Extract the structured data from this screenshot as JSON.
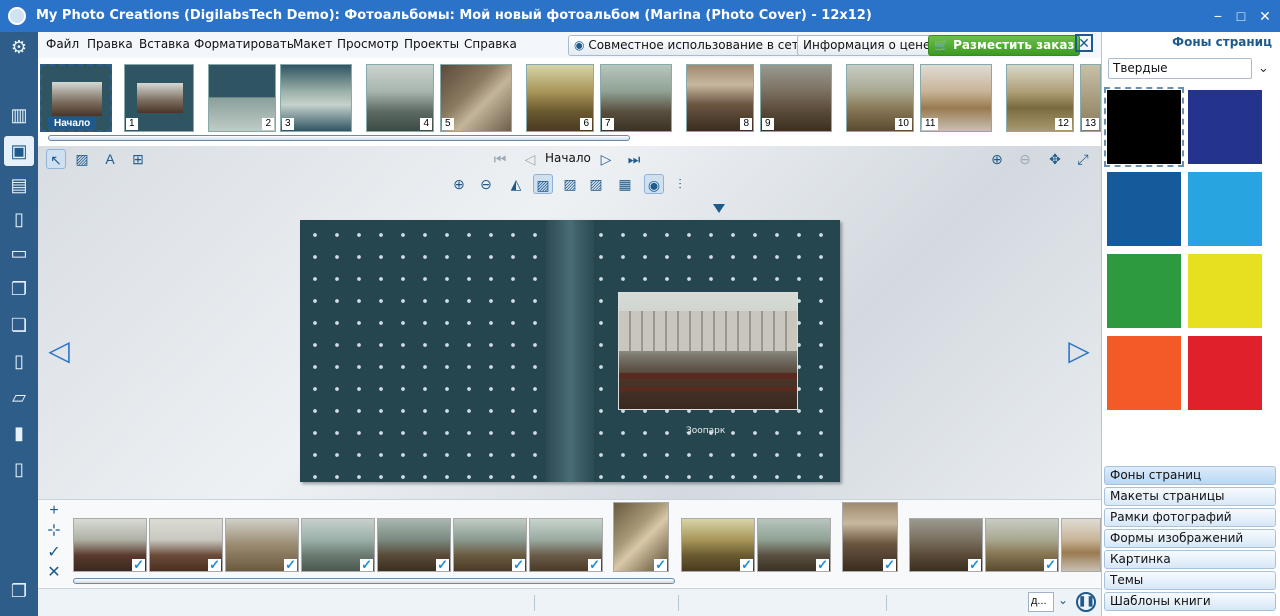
{
  "window": {
    "title": "My Photo Creations (DigilabsTech Demo): Фотоальбомы: Мой новый фотоальбом (Marina (Photo Cover) - 12x12)",
    "minimize": "−",
    "maximize": "□",
    "close": "✕"
  },
  "menu": {
    "items": [
      "Файл",
      "Правка",
      "Вставка",
      "Форматировать",
      "Макет",
      "Просмотр",
      "Проекты",
      "Справка"
    ],
    "share_button": "Совместное использование в сети",
    "price_button": "Информация о цене",
    "order_button": "Разместить заказ"
  },
  "filmstrip": {
    "start_label": "Начало",
    "numbers": [
      "1",
      "2",
      "3",
      "4",
      "5",
      "6",
      "7",
      "8",
      "9",
      "10",
      "11",
      "12",
      "13"
    ]
  },
  "toolbar": {
    "page_label": "Начало"
  },
  "book": {
    "caption": "Зоопарк"
  },
  "status": {
    "combo_value": "д..."
  },
  "right_panel": {
    "title": "Фоны страниц",
    "select_value": "Твердые",
    "swatches": [
      "#000000",
      "#24348e",
      "#155a9a",
      "#28a4e0",
      "#2e9a40",
      "#e6e020",
      "#f45a28",
      "#e0202a"
    ],
    "accordion": [
      "Фоны страниц",
      "Макеты страницы",
      "Рамки фотографий",
      "Формы изображений",
      "Картинка",
      "Темы",
      "Шаблоны книги"
    ]
  },
  "colors": {
    "accent": "#2a73c8",
    "sidebar": "#2d5d88",
    "book_background": "#26464f",
    "order_green": "#3b9a22"
  }
}
